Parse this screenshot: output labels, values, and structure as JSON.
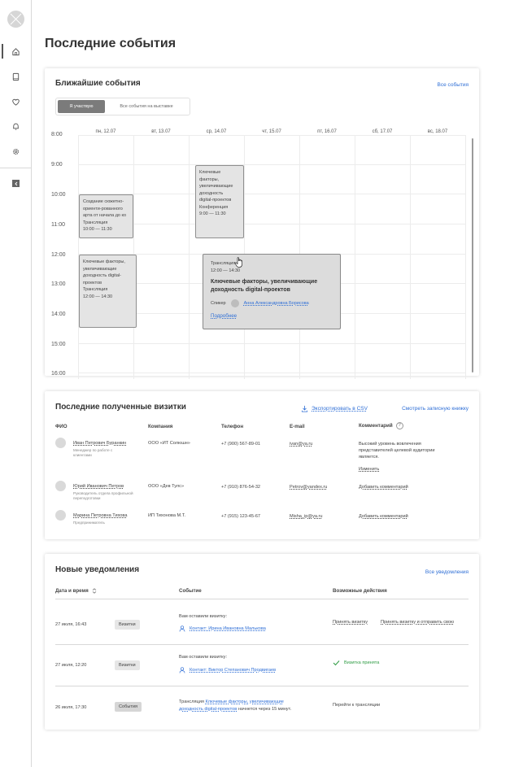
{
  "page": {
    "title": "Последние события"
  },
  "sidebar": {
    "items": [
      {
        "name": "home-icon",
        "active": true
      },
      {
        "name": "book-icon",
        "active": false
      },
      {
        "name": "heart-icon",
        "active": false
      },
      {
        "name": "bell-icon",
        "active": false
      },
      {
        "name": "gear-icon",
        "active": false
      }
    ]
  },
  "upcoming": {
    "title": "Ближайшие события",
    "all_link": "Все события",
    "toggle": {
      "active": "Я участвую",
      "inactive": "Все события на выставке"
    },
    "days": [
      "пн, 12.07",
      "вт, 13.07",
      "ср, 14.07",
      "чт, 15.07",
      "пт, 16.07",
      "сб, 17.07",
      "вс, 18.07"
    ],
    "hours": [
      "8:00",
      "9:00",
      "10:00",
      "11:00",
      "12:00",
      "13:00",
      "14:00",
      "15:00",
      "16:00"
    ],
    "events": [
      {
        "lines": [
          "Создание сюжетно-",
          "ориенти-рованного",
          "арта от начала до ко",
          "Трансляция",
          "10:00 — 11:30"
        ]
      },
      {
        "lines": [
          "Ключевые",
          "факторы,",
          "увеличивающие",
          "доходность",
          "digital-проектов",
          "Конференция",
          "9:00 — 11:30"
        ]
      },
      {
        "lines": [
          "Ключевые факторы,",
          "увеличивающие",
          "доходность digital-",
          "проектов",
          "Трансляция",
          "12:00 — 14:30"
        ]
      }
    ],
    "popup": {
      "type": "Трансляция",
      "time": "12:00 — 14:30",
      "title": "Ключевые факторы, увеличивающие доходность digital-проектов",
      "speaker_label": "Спикер",
      "speaker_name": "Анна Александровна Борисова",
      "more_link": "Подробнее"
    }
  },
  "cards": {
    "title": "Последние полученные визитки",
    "export_link": "Экспортировать в CSV",
    "notebook_link": "Смотреть записную книжку",
    "headers": {
      "name": "ФИО",
      "company": "Компания",
      "phone": "Телефон",
      "email": "E-mail",
      "comment": "Комментарий"
    },
    "rows": [
      {
        "name": "Иван Петрович Буранкин",
        "position": "Менеджер по работе с клиентами",
        "company": "ООО «ИТ Солюшн»",
        "phone": "+7 (900) 567-89-01",
        "email": "ivan@ya.ru",
        "comment": "Высокий уровень вовлечения представителей целевой аудитории является.",
        "action": "Изменить"
      },
      {
        "name": "Юрий Иванович Петров",
        "position": "Руководитель отдела профильной переподготовки",
        "company": "ООО «Дев Тулс»",
        "phone": "+7 (910) 876-54-32",
        "email": "Petrov@yandex.ru",
        "comment": "",
        "action": "Добавить комментарий"
      },
      {
        "name": "Марина Петровна Тихова",
        "position": "Предприниматель",
        "company": "ИП Тихонова М.Т.",
        "phone": "+7 (915) 123-45-67",
        "email": "Misha_ip@ya.ru",
        "comment": "",
        "action": "Добавить комментарий"
      }
    ]
  },
  "notifications": {
    "title": "Новые уведомления",
    "all_link": "Все уведомления",
    "headers": {
      "date": "Дата и время",
      "event": "Событие",
      "actions": "Возможные действия"
    },
    "rows": [
      {
        "date": "27 июля, 16:43",
        "badge": "Визитки",
        "text": "Вам оставили визитку:",
        "contact": "Контакт: Ирина Ивановна Малькова",
        "action1": "Принять визитку",
        "action2": "Принять визитку и отправить свою"
      },
      {
        "date": "27 июля, 12:20",
        "badge": "Визитки",
        "text": "Вам оставили визитку:",
        "contact": "Контакт: Виктор Степанович Продвигаев",
        "accepted": "Визитка принята"
      },
      {
        "date": "26 июля, 17:30",
        "badge": "События",
        "prefix": "Трансляция",
        "event_link1": "Ключевые факторы, увеличивающие",
        "event_link2": "доходность digital-проектов",
        "suffix": "начнется через 15 минут.",
        "action1": "Перейти к трансляции"
      }
    ]
  },
  "colors": {
    "accent": "#2f6fd6",
    "success": "#2e9b43"
  }
}
